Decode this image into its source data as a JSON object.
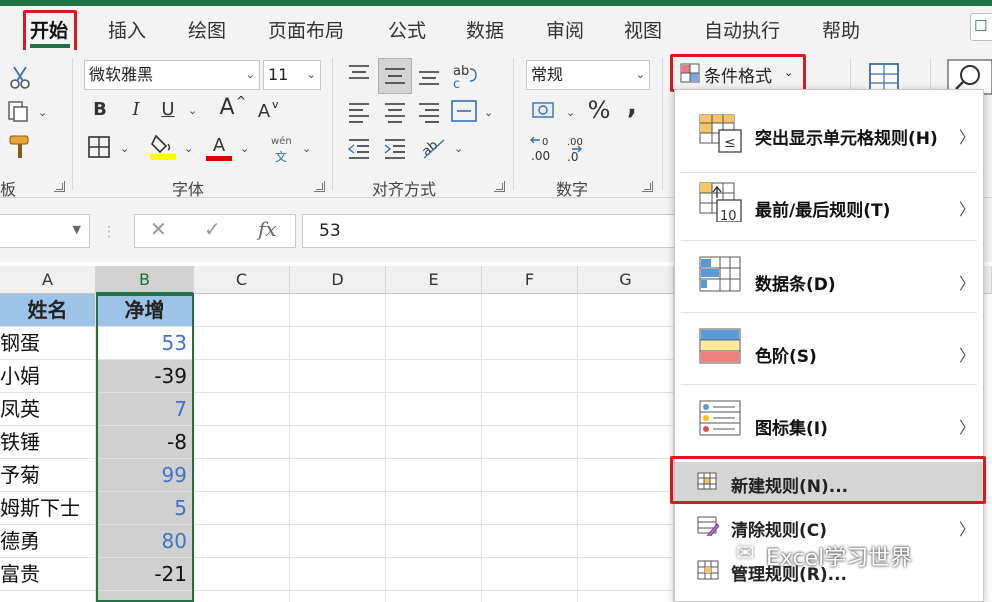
{
  "tabs": [
    {
      "label": "开始",
      "active": true
    },
    {
      "label": "插入"
    },
    {
      "label": "绘图"
    },
    {
      "label": "页面布局"
    },
    {
      "label": "公式"
    },
    {
      "label": "数据"
    },
    {
      "label": "审阅"
    },
    {
      "label": "视图"
    },
    {
      "label": "自动执行"
    },
    {
      "label": "帮助"
    }
  ],
  "ribbon": {
    "font_name": "微软雅黑",
    "font_size": "11",
    "number_format": "常规",
    "conditional_format_label": "条件格式",
    "groups": {
      "clipboard_fragment": "板",
      "font": "字体",
      "alignment": "对齐方式",
      "number": "数字"
    },
    "bold": "B",
    "italic": "I",
    "underline": "U",
    "grow_font": "A",
    "shrink_font": "A",
    "phonetic_top": "wén",
    "phonetic_bottom": "文",
    "percent": "%",
    "comma": ",",
    "fx": "fx",
    "font_color_letter": "A",
    "accent_colors": {
      "highlight": "#ffff00",
      "font_color": "#e00000",
      "brand": "#217346",
      "alert": "#d71920"
    }
  },
  "formula_bar": {
    "cancel": "✕",
    "enter": "✓",
    "value": "53"
  },
  "grid": {
    "columns": [
      "A",
      "B",
      "C",
      "D",
      "E",
      "F",
      "G"
    ],
    "header_row": [
      "姓名",
      "净增"
    ],
    "rows": [
      {
        "name": "钢蛋",
        "value": "53"
      },
      {
        "name": "小娟",
        "value": "-39"
      },
      {
        "name": "凤英",
        "value": "7"
      },
      {
        "name": "铁锤",
        "value": "-8"
      },
      {
        "name": "予菊",
        "value": "99"
      },
      {
        "name": "姆斯下士",
        "value": "5"
      },
      {
        "name": "德勇",
        "value": "80"
      },
      {
        "name": "富贵",
        "value": "-21"
      }
    ]
  },
  "menu": {
    "items": [
      {
        "label": "突出显示单元格规则(H)",
        "submenu": true
      },
      {
        "label": "最前/最后规则(T)",
        "submenu": true
      },
      {
        "label": "数据条(D)",
        "submenu": true
      },
      {
        "label": "色阶(S)",
        "submenu": true
      },
      {
        "label": "图标集(I)",
        "submenu": true
      }
    ],
    "new_rule": "新建规则(N)...",
    "clear_rules": "清除规则(C)",
    "manage_rules": "管理规则(R)...",
    "icon_number": "10"
  },
  "watermark": "Excel学习世界"
}
